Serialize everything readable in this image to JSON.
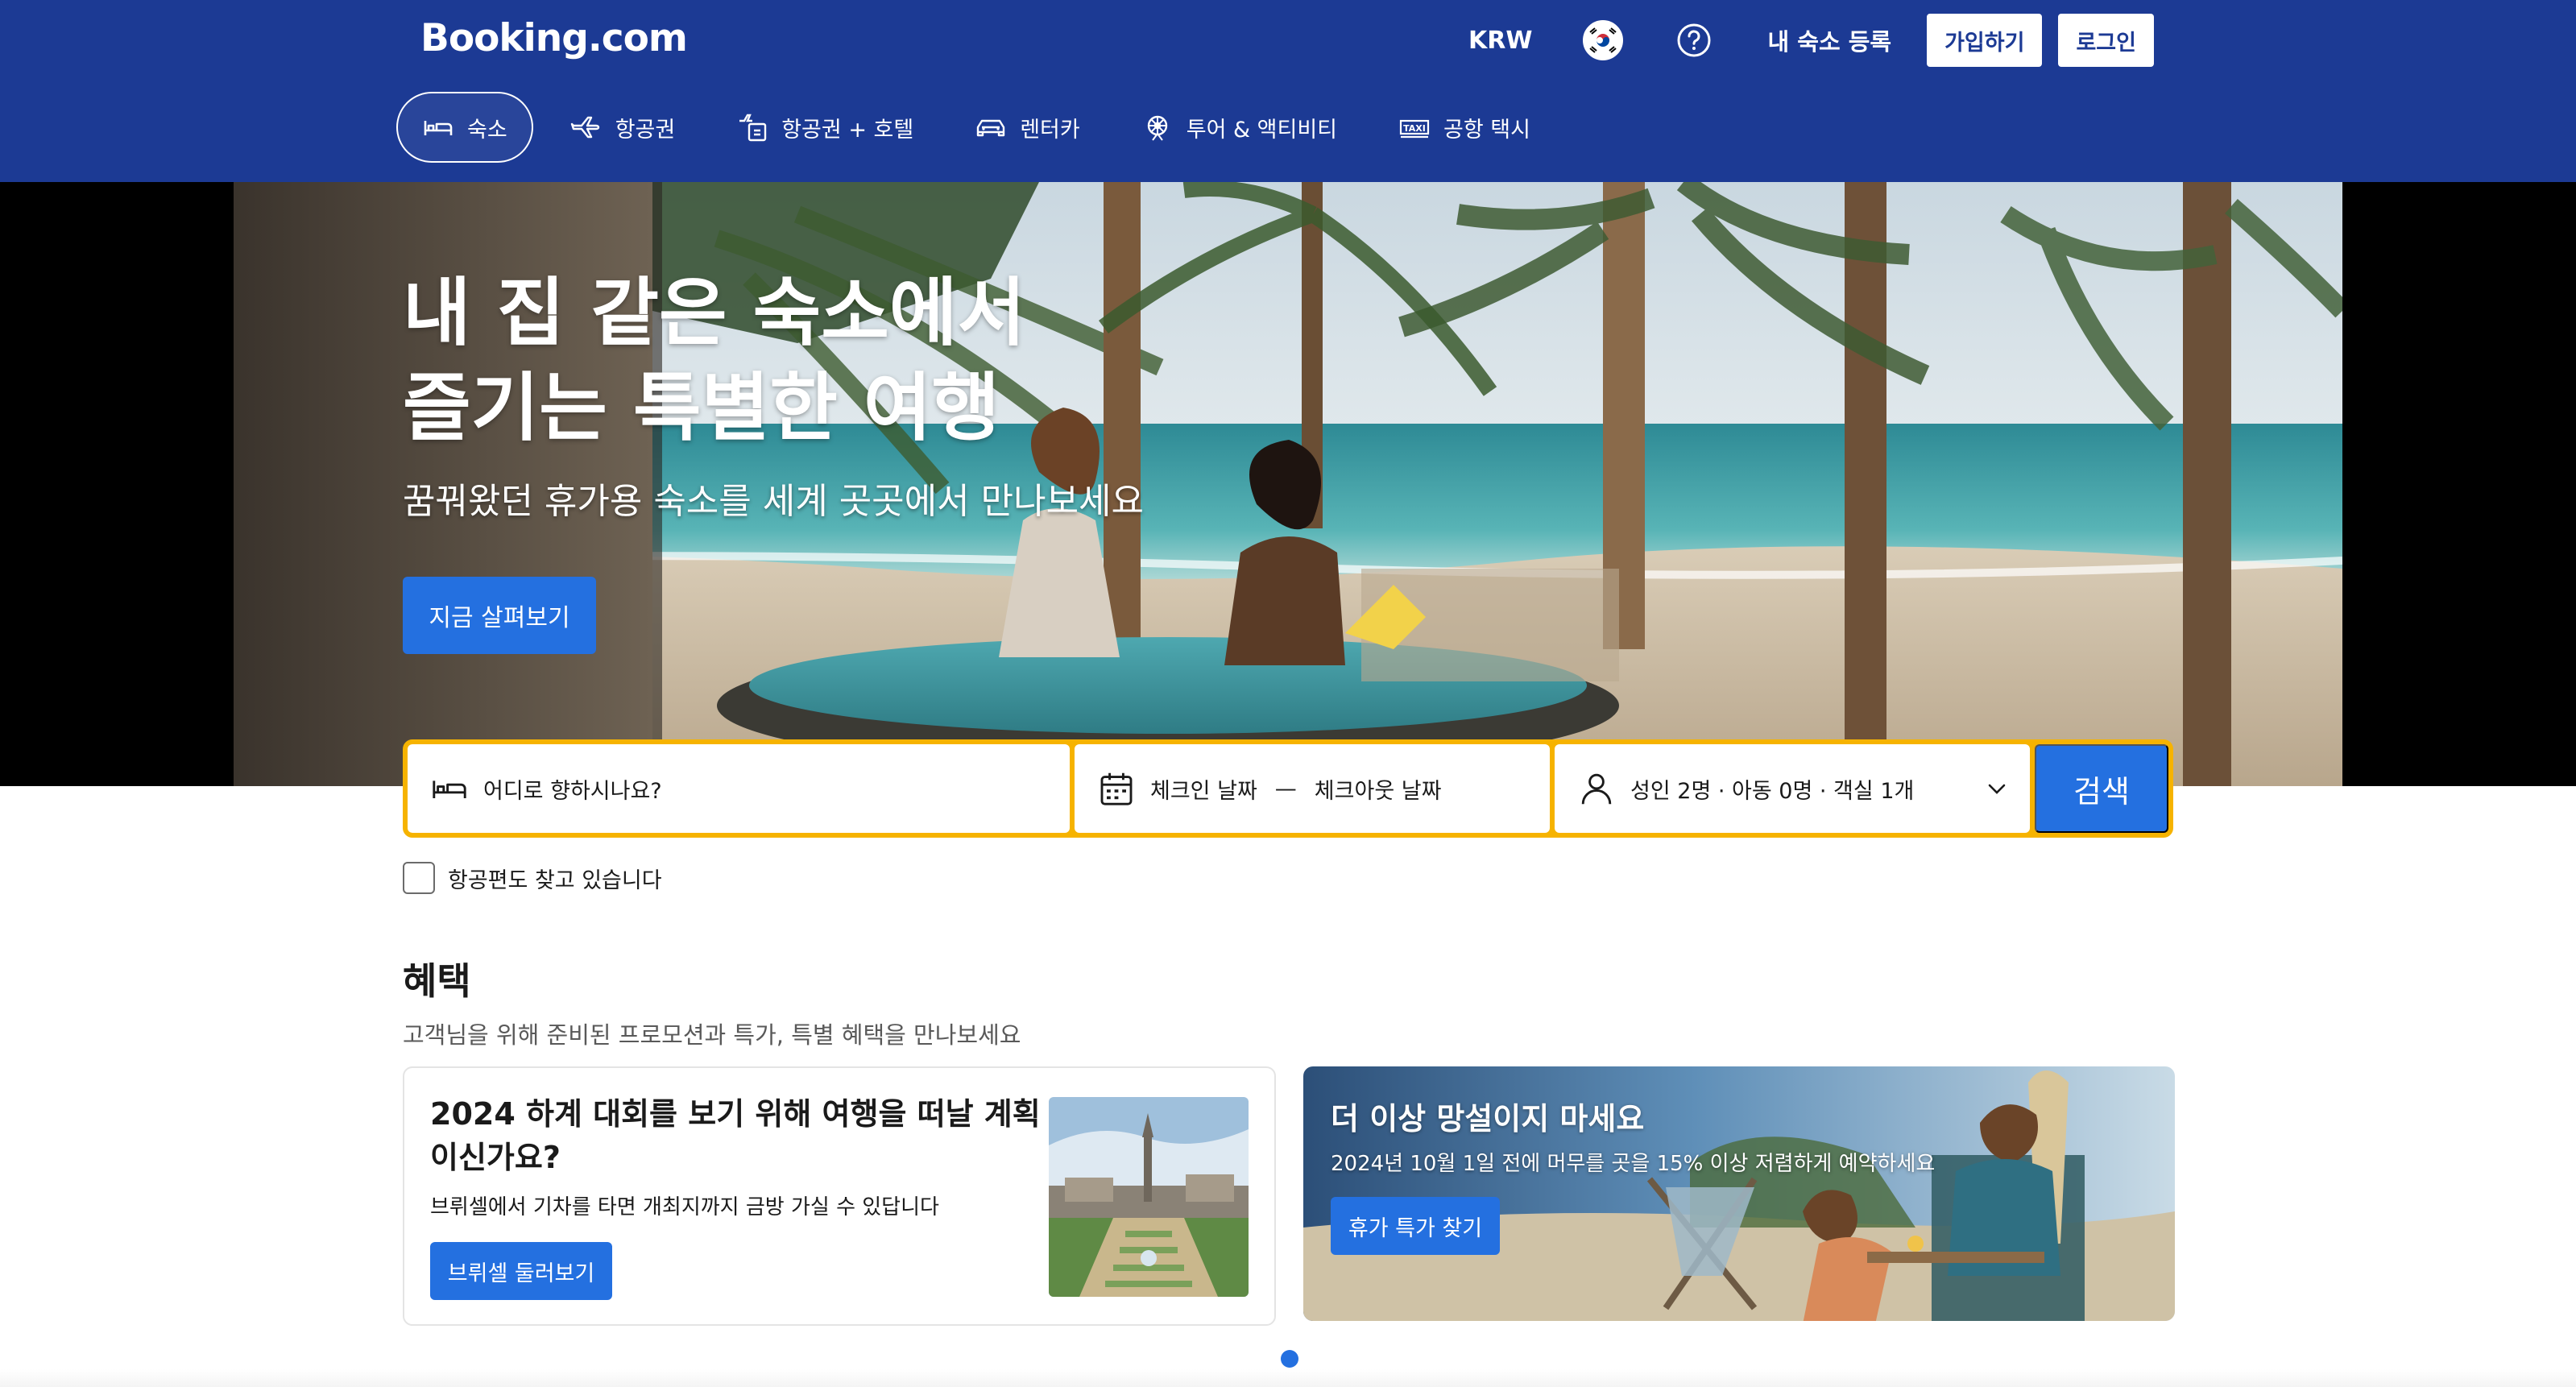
{
  "header": {
    "logo": "Booking.com",
    "currency": "KRW",
    "list_property": "내 숙소 등록",
    "register": "가입하기",
    "sign_in": "로그인",
    "colors": {
      "brand": "#1c3a94",
      "accent": "#2470e0",
      "search_border": "#f6b300"
    }
  },
  "nav": {
    "items": [
      {
        "label": "숙소",
        "icon": "bed-icon",
        "active": true
      },
      {
        "label": "항공권",
        "icon": "plane-icon"
      },
      {
        "label": "항공권 + 호텔",
        "icon": "plane-hotel-icon"
      },
      {
        "label": "렌터카",
        "icon": "car-icon"
      },
      {
        "label": "투어 & 액티비티",
        "icon": "attractions-icon"
      },
      {
        "label": "공항 택시",
        "icon": "taxi-icon"
      }
    ]
  },
  "hero": {
    "title": "내 집 같은 숙소에서\n즐기는 특별한 여행",
    "subtitle": "꿈꿔왔던 휴가용 숙소를 세계 곳곳에서 만나보세요",
    "cta": "지금 살펴보기"
  },
  "search": {
    "destination_placeholder": "어디로 향하시나요?",
    "checkin": "체크인 날짜",
    "separator": "—",
    "checkout": "체크아웃 날짜",
    "guests": "성인 2명 · 아동 0명 · 객실 1개",
    "button": "검색",
    "flight_checkbox": "항공편도 찾고 있습니다"
  },
  "deals": {
    "title": "혜택",
    "subtitle": "고객님을 위해 준비된 프로모션과 특가, 특별 혜택을 만나보세요",
    "card1": {
      "title": "2024 하계 대회를 보기 위해 여행을 떠날 계획이신가요?",
      "description": "브뤼셀에서 기차를 타면 개최지까지 금방 가실 수 있답니다",
      "button": "브뤼셀 둘러보기"
    },
    "card2": {
      "title": "더 이상 망설이지 마세요",
      "description": "2024년 10월 1일 전에 머무를 곳을 15% 이상 저렴하게 예약하세요",
      "button": "휴가 특가 찾기"
    }
  }
}
